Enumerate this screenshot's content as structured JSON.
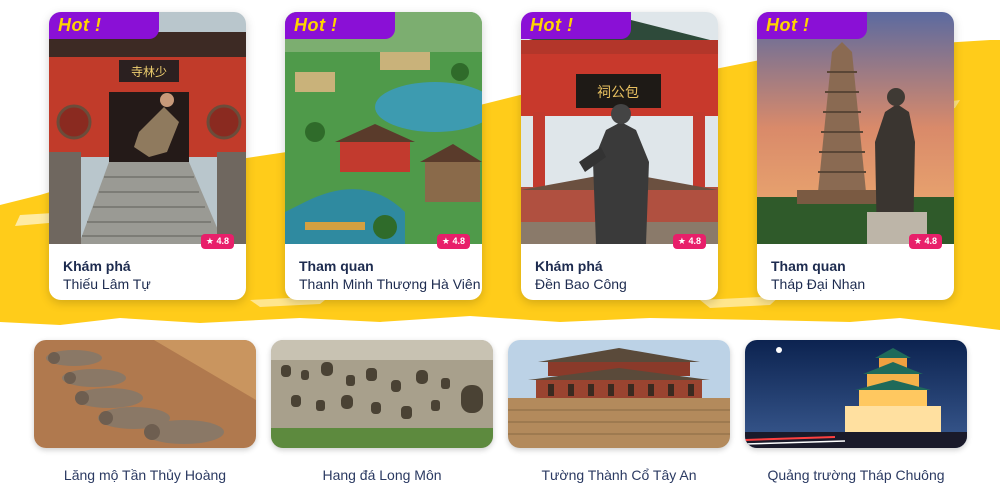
{
  "featured": {
    "badge_text": "Hot !",
    "cards": [
      {
        "action": "Khám phá",
        "place": "Thiếu Lâm Tự",
        "rating": "★ 4.8",
        "image": "shaolin-temple-photo"
      },
      {
        "action": "Tham quan",
        "place": "Thanh Minh Thượng Hà Viên",
        "rating": "★ 4.8",
        "image": "qingming-garden-photo"
      },
      {
        "action": "Khám phá",
        "place": "Đền Bao Công",
        "rating": "★ 4.8",
        "image": "bao-gong-temple-photo"
      },
      {
        "action": "Tham quan",
        "place": "Tháp Đại Nhạn",
        "rating": "★ 4.8",
        "image": "giant-wild-goose-pagoda-photo"
      }
    ]
  },
  "destinations": [
    {
      "caption": "Lăng mộ Tần Thủy Hoàng",
      "image": "terracotta-army-photo"
    },
    {
      "caption": "Hang đá Long Môn",
      "image": "longmen-grottoes-photo"
    },
    {
      "caption": "Tường Thành Cổ Tây An",
      "image": "xian-city-wall-photo"
    },
    {
      "caption": "Quảng trường Tháp Chuông",
      "image": "bell-tower-square-photo"
    }
  ],
  "colors": {
    "hot_badge_bg": "#8a10d6",
    "hot_badge_text": "#ffd400",
    "rating_badge_bg": "#e81f6a",
    "brush_yellow": "#ffcc1a",
    "title_text": "#1d2b4f"
  }
}
